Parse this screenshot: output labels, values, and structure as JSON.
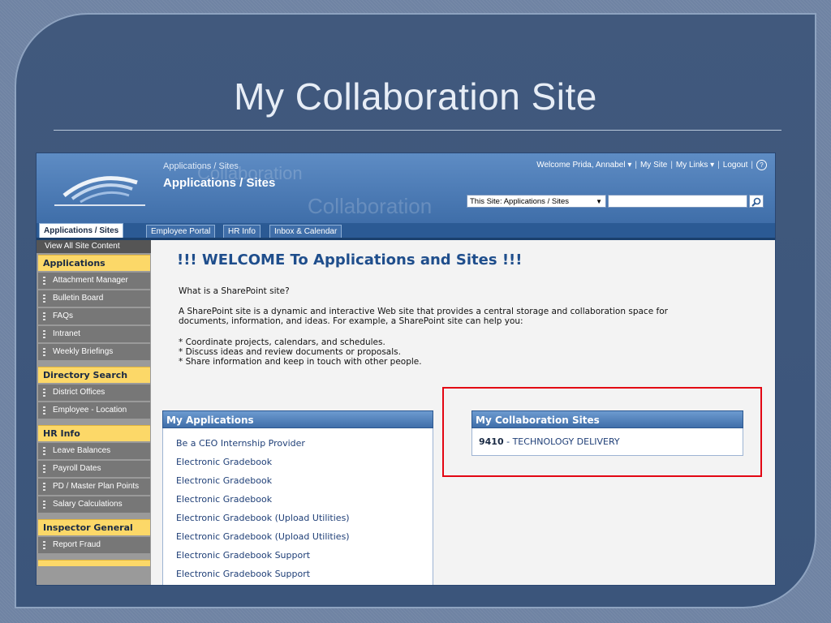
{
  "slide": {
    "title": "My Collaboration Site"
  },
  "banner": {
    "watermark_1": "Collaboration",
    "watermark_2": "Collaboration",
    "breadcrumb": "Applications / Sites",
    "site_title": "Applications / Sites",
    "welcome_user": "Welcome Prida, Annabel",
    "my_site": "My Site",
    "my_links": "My Links",
    "logout": "Logout",
    "scope_select": "This Site: Applications / Sites",
    "search_placeholder": ""
  },
  "tabs": [
    {
      "label": "Applications / Sites"
    },
    {
      "label": "Employee Portal"
    },
    {
      "label": "HR Info"
    },
    {
      "label": "Inbox & Calendar"
    }
  ],
  "leftnav": {
    "view_all": "View All Site Content",
    "sections": [
      {
        "heading": "Applications",
        "items": [
          "Attachment Manager",
          "Bulletin Board",
          "FAQs",
          "Intranet",
          "Weekly Briefings"
        ]
      },
      {
        "heading": "Directory Search",
        "items": [
          "District Offices",
          "Employee - Location"
        ]
      },
      {
        "heading": "HR Info",
        "items": [
          "Leave Balances",
          "Payroll Dates",
          "PD / Master Plan Points",
          "Salary Calculations"
        ]
      },
      {
        "heading": "Inspector General",
        "items": [
          "Report Fraud"
        ]
      }
    ]
  },
  "main": {
    "welcome_title": "!!! WELCOME  To Applications and Sites !!!",
    "question": "What is a SharePoint site?",
    "para_1": "A SharePoint site is a dynamic and interactive Web site that provides a central storage and collaboration space for",
    "para_2": "documents, information, and ideas. For example, a SharePoint site can help you:",
    "bullet_1": "* Coordinate projects, calendars, and schedules.",
    "bullet_2": "* Discuss ideas and review documents or proposals.",
    "bullet_3": "* Share information and keep in touch with other people."
  },
  "my_applications": {
    "heading": "My Applications",
    "items": [
      "Be a CEO Internship Provider",
      "Electronic Gradebook",
      "Electronic Gradebook",
      "Electronic Gradebook",
      "Electronic Gradebook (Upload Utilities)",
      "Electronic Gradebook (Upload Utilities)",
      "Electronic Gradebook Support",
      "Electronic Gradebook Support"
    ]
  },
  "my_collab_sites": {
    "heading": "My Collaboration Sites",
    "code": "9410",
    "name": "- TECHNOLOGY DELIVERY"
  },
  "colors": {
    "highlight_frame": "#e30613",
    "nav_heading": "#fcd868",
    "panel_header": "#3f6ea9"
  }
}
